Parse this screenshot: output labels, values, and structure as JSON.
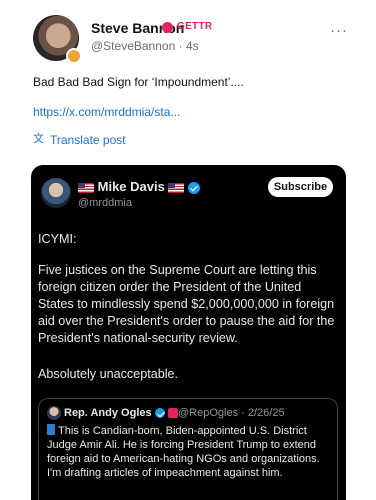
{
  "post": {
    "author_name": "Steve Bannon",
    "platform_badge": "GETTR",
    "handle": "@SteveBannon",
    "time": "4s",
    "text": "Bad Bad Bad Sign for ‘Impoundment’....",
    "link": "https://x.com/mrddmia/sta...",
    "translate_label": "Translate post",
    "more_label": "···"
  },
  "embed": {
    "author_name": "Mike Davis",
    "handle": "@mrddmia",
    "subscribe_label": "Subscribe",
    "paragraph1": "ICYMI:",
    "paragraph2": "Five justices on the Supreme Court are letting this foreign citizen order the President of the United States to mindlessly spend $2,000,000,000 in foreign aid over the President's order to pause the aid for the President's national-security review.",
    "paragraph3": "Absolutely unacceptable.",
    "quote": {
      "author_name": "Rep. Andy Ogles",
      "handle": "@RepOgles",
      "date": "2/26/25",
      "text": "This is Candian-born, Biden-appointed U.S. District Judge Amir Ali. He is forcing President Trump to extend foreign aid to American-hating NGOs and organizations. I'm drafting articles of impeachment against him."
    }
  },
  "colors": {
    "link": "#1d6fd6",
    "card_bg": "#000000",
    "verified_blue": "#1d9bf0",
    "gettr_red": "#e0245e"
  }
}
